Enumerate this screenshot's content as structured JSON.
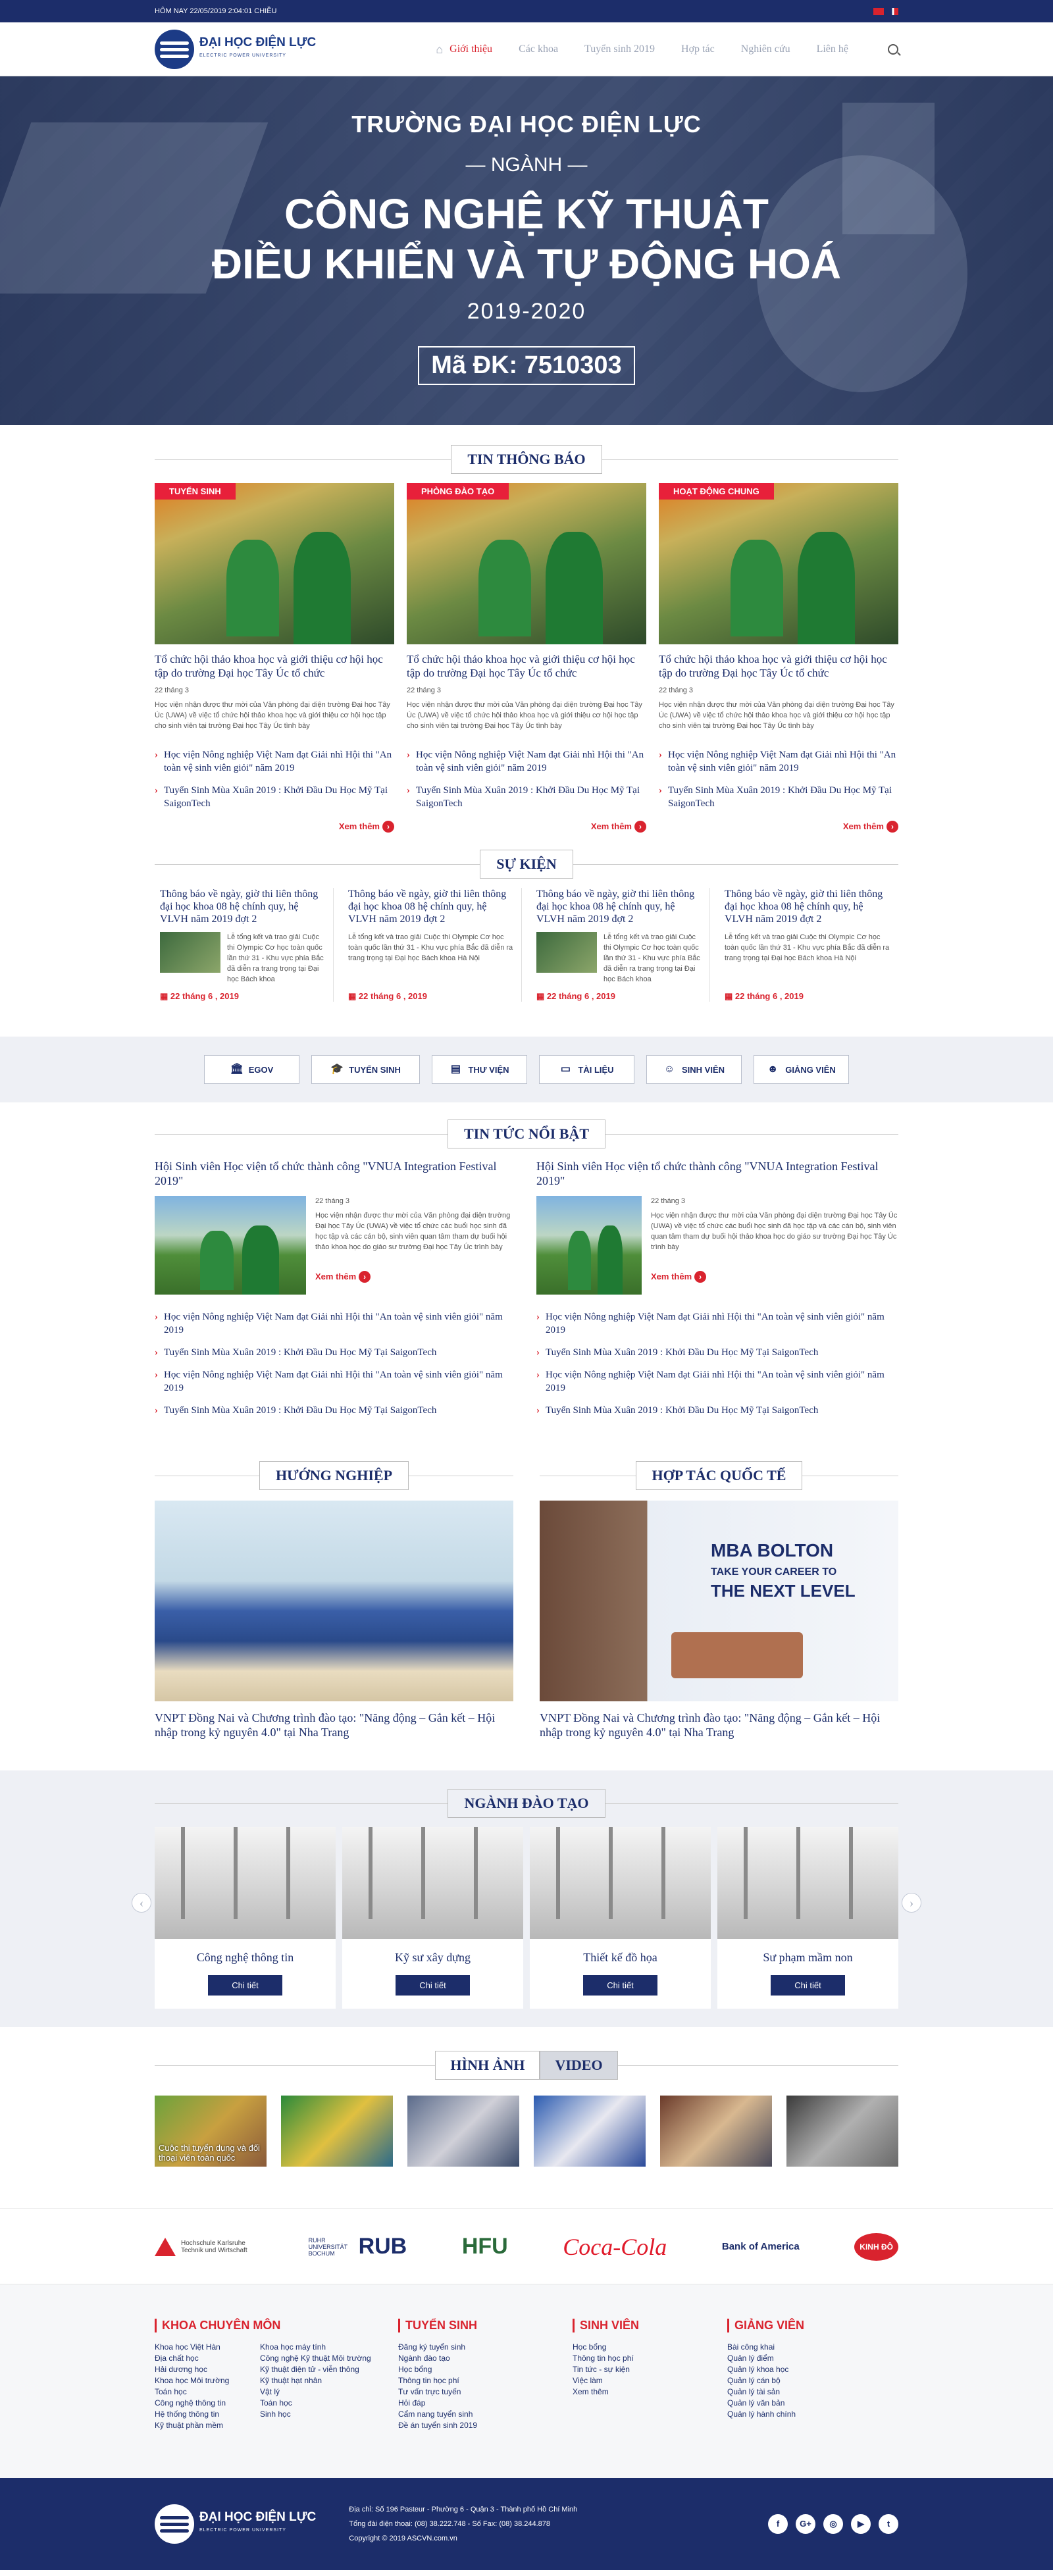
{
  "topbar": {
    "date": "HÔM NAY 22/05/2019 2:04:01 CHIỀU"
  },
  "header": {
    "logo_name": "ĐẠI HỌC ĐIỆN LỰC",
    "logo_sub": "ELECTRIC POWER UNIVERSITY",
    "nav": [
      {
        "label": "Giới thiệu"
      },
      {
        "label": "Các khoa"
      },
      {
        "label": "Tuyển sinh 2019"
      },
      {
        "label": "Hợp tác"
      },
      {
        "label": "Nghiên cứu"
      },
      {
        "label": "Liên hệ"
      }
    ]
  },
  "hero": {
    "line1": "TRƯỜNG ĐẠI HỌC ĐIỆN LỰC",
    "line2": "NGÀNH",
    "line3": "CÔNG NGHỆ KỸ THUẬT",
    "line4": "ĐIỀU KHIỂN VÀ TỰ ĐỘNG HOÁ",
    "line5": "2019-2020",
    "code": "Mã ĐK: 7510303"
  },
  "notices": {
    "title": "TIN THÔNG BÁO",
    "cards": [
      {
        "tag": "TUYỂN SINH",
        "headline": "Tổ chức hội thảo khoa học và giới thiệu cơ hội học tập do trường Đại học Tây Úc tổ chức",
        "date": "22 tháng 3",
        "summary": "Học viện nhận được thư mời của Văn phòng đại diện trường Đại học Tây Úc (UWA) về việc tổ chức hội thảo khoa học và giới thiệu cơ hội học tập cho sinh viên tại trường Đại học Tây Úc tình bày",
        "links": [
          "Học viện Nông nghiệp Việt Nam đạt Giải nhì Hội thi \"An toàn vệ sinh viên giỏi\" năm 2019",
          "Tuyển Sinh Mùa Xuân 2019 : Khởi Đầu Du Học Mỹ Tại SaigonTech"
        ],
        "more": "Xem thêm"
      },
      {
        "tag": "PHÒNG ĐÀO TẠO",
        "headline": "Tổ chức hội thảo khoa học và giới thiệu cơ hội học tập do trường Đại học Tây Úc tổ chức",
        "date": "22 tháng 3",
        "summary": "Học viện nhận được thư mời của Văn phòng đại diện trường Đại học Tây Úc (UWA) về việc tổ chức hội thảo khoa học và giới thiệu cơ hội học tập cho sinh viên tại trường Đại học Tây Úc tình bày",
        "links": [
          "Học viện Nông nghiệp Việt Nam đạt Giải nhì Hội thi \"An toàn vệ sinh viên giỏi\" năm 2019",
          "Tuyển Sinh Mùa Xuân 2019 : Khởi Đầu Du Học Mỹ Tại SaigonTech"
        ],
        "more": "Xem thêm"
      },
      {
        "tag": "HOẠT ĐỘNG CHUNG",
        "headline": "Tổ chức hội thảo khoa học và giới thiệu cơ hội học tập do trường Đại học Tây Úc tổ chức",
        "date": "22 tháng 3",
        "summary": "Học viện nhận được thư mời của Văn phòng đại diện trường Đại học Tây Úc (UWA) về việc tổ chức hội thảo khoa học và giới thiệu cơ hội học tập cho sinh viên tại trường Đại học Tây Úc tình bày",
        "links": [
          "Học viện Nông nghiệp Việt Nam đạt Giải nhì Hội thi \"An toàn vệ sinh viên giỏi\" năm 2019",
          "Tuyển Sinh Mùa Xuân 2019 : Khởi Đầu Du Học Mỹ Tại SaigonTech"
        ],
        "more": "Xem thêm"
      }
    ]
  },
  "events": {
    "title": "SỰ KIỆN",
    "items": [
      {
        "headline": "Thông báo về ngày, giờ thi liên thông đại học khoa 08 hệ chính quy, hệ VLVH năm 2019 đợt 2",
        "summary": "Lễ tổng kết và trao giải Cuộc thi Olympic Cơ học toàn quốc lần thứ 31 - Khu vực phía Bắc đã diễn ra trang trọng tại Đại học Bách khoa",
        "date": "22 tháng 6 , 2019"
      },
      {
        "headline": "Thông báo về ngày, giờ thi liên thông đại học khoa 08 hệ chính quy, hệ VLVH năm 2019 đợt 2",
        "summary": "Lễ tổng kết và trao giải Cuộc thi Olympic Cơ học toàn quốc lần thứ 31 - Khu vực phía Bắc đã diễn ra trang trọng tại Đại học Bách khoa Hà Nội",
        "date": "22 tháng 6 , 2019"
      },
      {
        "headline": "Thông báo về ngày, giờ thi liên thông đại học khoa 08 hệ chính quy, hệ VLVH năm 2019 đợt 2",
        "summary": "Lễ tổng kết và trao giải Cuộc thi Olympic Cơ học toàn quốc lần thứ 31 - Khu vực phía Bắc đã diễn ra trang trọng tại Đại học Bách khoa",
        "date": "22 tháng 6 , 2019"
      },
      {
        "headline": "Thông báo về ngày, giờ thi liên thông đại học khoa 08 hệ chính quy, hệ VLVH năm 2019 đợt 2",
        "summary": "Lễ tổng kết và trao giải Cuộc thi Olympic Cơ học toàn quốc lần thứ 31 - Khu vực phía Bắc đã diễn ra trang trọng tại Đại học Bách khoa Hà Nội",
        "date": "22 tháng 6 , 2019"
      }
    ]
  },
  "quicklinks": [
    {
      "label": "EGOV",
      "icon": "bank-icon"
    },
    {
      "label": "TUYỂN SINH",
      "icon": "grad-cap-icon"
    },
    {
      "label": "THƯ VIỆN",
      "icon": "library-icon"
    },
    {
      "label": "TÀI LIỆU",
      "icon": "document-icon"
    },
    {
      "label": "SINH VIÊN",
      "icon": "student-icon"
    },
    {
      "label": "GIẢNG VIÊN",
      "icon": "teacher-icon"
    }
  ],
  "news": {
    "title": "TIN TỨC NỔI BẬT",
    "cols": [
      {
        "headline": "Hội Sinh viên Học viện tổ chức thành công \"VNUA Integration Festival 2019\"",
        "date": "22 tháng 3",
        "summary": "Học viện nhận được thư mời của Văn phòng đại diện trường Đại học Tây Úc (UWA) về việc tổ chức các buổi học sinh đã học tập và các cán bộ, sinh viên quan tâm tham dự buổi hội thảo khoa học do giáo sư trường Đại học Tây Úc trình bày",
        "more": "Xem thêm",
        "links": [
          "Học viện Nông nghiệp Việt Nam đạt Giải nhì Hội thi \"An toàn vệ sinh viên giỏi\" năm 2019",
          "Tuyển Sinh Mùa Xuân 2019 : Khởi Đầu Du Học Mỹ Tại SaigonTech",
          "Học viện Nông nghiệp Việt Nam đạt Giải nhì Hội thi \"An toàn vệ sinh viên giỏi\" năm 2019",
          "Tuyển Sinh Mùa Xuân 2019 : Khởi Đầu Du Học Mỹ Tại SaigonTech"
        ]
      },
      {
        "headline": "Hội Sinh viên Học viện tổ chức thành công \"VNUA Integration Festival 2019\"",
        "date": "22 tháng 3",
        "summary": "Học viện nhận được thư mời của Văn phòng đại diện trường Đại học Tây Úc (UWA) về việc tổ chức các buổi học sinh đã học tập và các cán bộ, sinh viên quan tâm tham dự buổi hội thảo khoa học do giáo sư trường Đại học Tây Úc trình bày",
        "more": "Xem thêm",
        "links": [
          "Học viện Nông nghiệp Việt Nam đạt Giải nhì Hội thi \"An toàn vệ sinh viên giỏi\" năm 2019",
          "Tuyển Sinh Mùa Xuân 2019 : Khởi Đầu Du Học Mỹ Tại SaigonTech",
          "Học viện Nông nghiệp Việt Nam đạt Giải nhì Hội thi \"An toàn vệ sinh viên giỏi\" năm 2019",
          "Tuyển Sinh Mùa Xuân 2019 : Khởi Đầu Du Học Mỹ Tại SaigonTech"
        ]
      }
    ]
  },
  "career": {
    "title": "HƯỚNG NGHIỆP",
    "caption": "VNPT Đồng Nai và Chương trình đào tạo: \"Năng động – Gắn kết – Hội nhập trong kỷ nguyên 4.0\" tại Nha Trang"
  },
  "intl": {
    "title": "HỢP TÁC QUỐC TẾ",
    "caption": "VNPT Đồng Nai và Chương trình đào tạo: \"Năng động – Gắn kết – Hội nhập trong kỷ nguyên 4.0\" tại Nha Trang",
    "banner1": "MBA BOLTON",
    "banner2": "TAKE YOUR CAREER TO",
    "banner3": "THE NEXT LEVEL"
  },
  "majors": {
    "title": "NGÀNH ĐÀO TẠO",
    "button": "Chi tiết",
    "items": [
      "Công nghệ thông tin",
      "Kỹ sư xây dựng",
      "Thiết kế đồ họa",
      "Sư phạm mầm non"
    ]
  },
  "media": {
    "tab_images": "HÌNH ẢNH",
    "tab_video": "VIDEO",
    "caption": "Cuộc thi tuyển dụng và đối thoại viên toàn quốc"
  },
  "partners": [
    "Hochschule Karlsruhe Technik und Wirtschaft",
    "RUHR UNIVERSITÄT BOCHUM",
    "RUB",
    "HFU",
    "Coca-Cola",
    "Bank of America",
    "KINH ĐÔ"
  ],
  "footer_cols": [
    {
      "title": "KHOA CHUYÊN MÔN",
      "links": [
        "Khoa học Việt Hàn",
        "Địa chất học",
        "Hải dương học",
        "Khoa học Môi trường",
        "Toán học",
        "Công nghệ thông tin",
        "Hệ thống thông tin",
        "Kỹ thuật phần mềm"
      ],
      "links2": [
        "Khoa học máy tính",
        "Công nghệ Kỹ thuật Môi trường",
        "Kỹ thuật điện tử - viễn thông",
        "Kỹ thuật hạt nhân",
        "Vật lý",
        "Toán học",
        "Sinh học"
      ]
    },
    {
      "title": "TUYỂN SINH",
      "links": [
        "Đăng ký tuyển sinh",
        "Ngành đào tạo",
        "Học bổng",
        "Thông tin học phí",
        "Tư vấn trực tuyến",
        "Hỏi đáp",
        "Cẩm nang tuyển sinh",
        "Đề án tuyển sinh 2019"
      ]
    },
    {
      "title": "SINH VIÊN",
      "links": [
        "Học bổng",
        "Thông tin học phí",
        "Tin tức - sự kiện",
        "Việc làm",
        "Xem thêm"
      ]
    },
    {
      "title": "GIẢNG VIÊN",
      "links": [
        "Bài công khai",
        "Quản lý điểm",
        "Quản lý khoa học",
        "Quản lý cán bộ",
        "Quản lý tài sản",
        "Quản lý văn bản",
        "Quản lý hành chính"
      ]
    }
  ],
  "footer": {
    "address": "Địa chỉ: Số 196 Pasteur - Phường 6 - Quận 3 - Thành phố Hồ Chí Minh",
    "phone": "Tổng đài điện thoại: (08) 38.222.748 - Số Fax: (08) 38.244.878",
    "copyright": "Copyright © 2019 ASCVN.com.vn",
    "social": [
      "f",
      "G+",
      "◎",
      "▶",
      "t"
    ]
  },
  "colors": {
    "primary": "#1c2d6a",
    "accent": "#d9232e"
  }
}
